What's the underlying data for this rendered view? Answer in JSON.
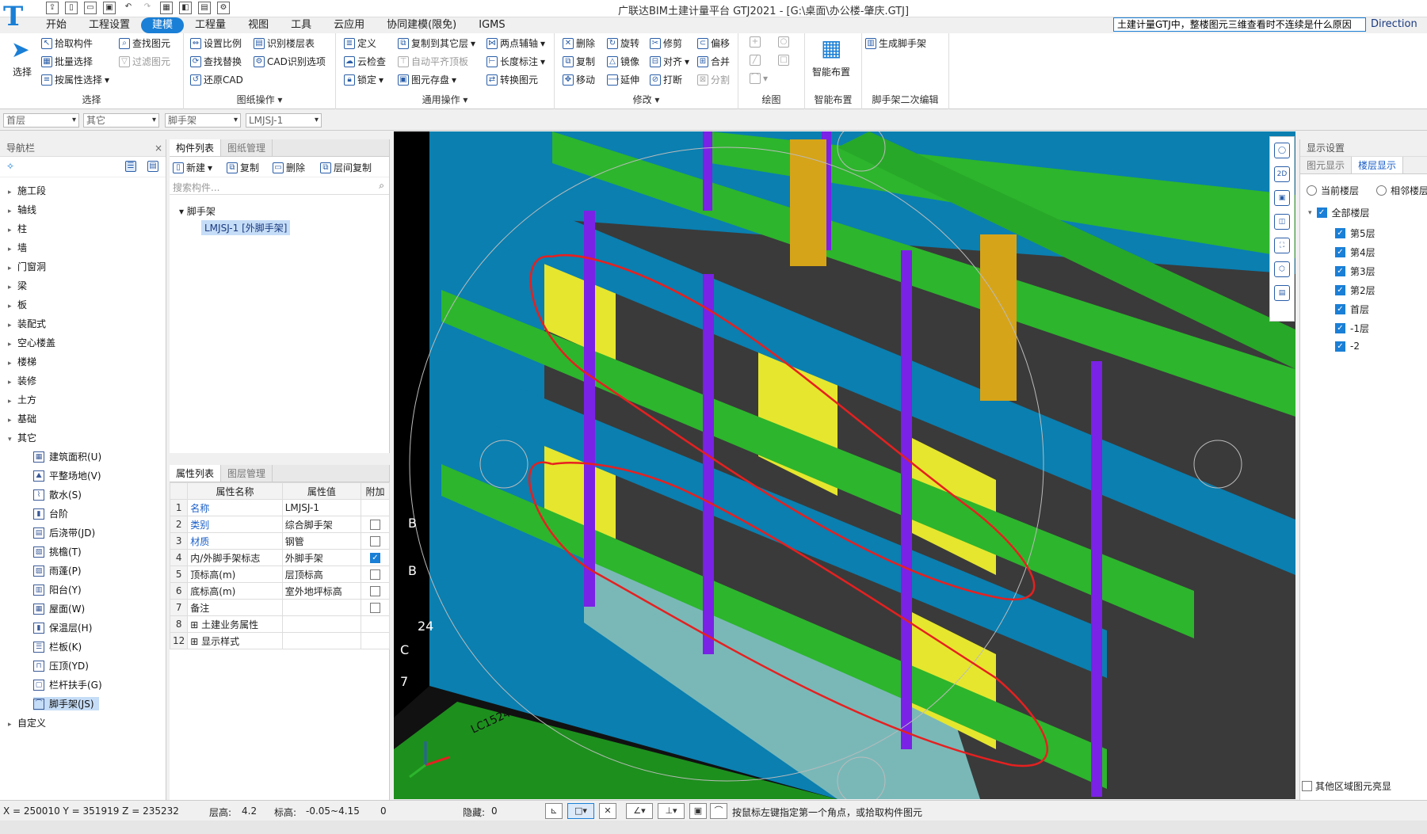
{
  "window": {
    "title": "广联达BIM土建计量平台 GTJ2021 - [G:\\桌面\\办公楼-肇庆.GTJ]",
    "logo": "T"
  },
  "menu": [
    "开始",
    "工程设置",
    "建模",
    "工程量",
    "视图",
    "工具",
    "云应用",
    "协同建模(限免)",
    "IGMS"
  ],
  "help_search": "土建计量GTJ中，整楼图元三维查看时不连续是什么原因",
  "direction_label": "Direction",
  "ribbon": {
    "select": {
      "label": "选择",
      "big": "选择",
      "items": [
        "拾取构件",
        "批量选择",
        "按属性选择",
        "查找图元",
        "过滤图元"
      ]
    },
    "drawing": {
      "label": "图纸操作",
      "items": [
        "设置比例",
        "查找替换",
        "还原CAD",
        "识别楼层表",
        "CAD识别选项"
      ]
    },
    "general": {
      "label": "通用操作",
      "items": [
        "定义",
        "云检查",
        "锁定",
        "复制到其它层",
        "自动平齐顶板",
        "图元存盘",
        "两点辅轴",
        "长度标注",
        "转换图元"
      ]
    },
    "modify": {
      "label": "修改",
      "items": [
        "删除",
        "复制",
        "移动",
        "旋转",
        "镜像",
        "延伸",
        "修剪",
        "对齐",
        "打断",
        "偏移",
        "合并",
        "分割"
      ]
    },
    "draw": {
      "label": "绘图"
    },
    "smart": {
      "label": "智能布置",
      "big": "智能布置"
    },
    "scaffold": {
      "label": "脚手架二次编辑",
      "items": [
        "生成脚手架"
      ]
    }
  },
  "selectors": [
    "首层",
    "其它",
    "脚手架",
    "LMJSJ-1"
  ],
  "nav": {
    "title": "导航栏",
    "items": [
      "施工段",
      "轴线",
      "柱",
      "墙",
      "门窗洞",
      "梁",
      "板",
      "装配式",
      "空心楼盖",
      "楼梯",
      "装修",
      "土方",
      "基础",
      "其它"
    ],
    "sub_items": [
      "建筑面积(U)",
      "平整场地(V)",
      "散水(S)",
      "台阶",
      "后浇带(JD)",
      "挑檐(T)",
      "雨蓬(P)",
      "阳台(Y)",
      "屋面(W)",
      "保温层(H)",
      "栏板(K)",
      "压顶(YD)",
      "栏杆扶手(G)",
      "脚手架(JS)"
    ],
    "last": "自定义"
  },
  "component": {
    "tabs": [
      "构件列表",
      "图纸管理"
    ],
    "tools": [
      "新建",
      "复制",
      "删除",
      "层间复制"
    ],
    "search_placeholder": "搜索构件...",
    "tree_root": "脚手架",
    "tree_item": "LMJSJ-1 [外脚手架]"
  },
  "props": {
    "tabs": [
      "属性列表",
      "图层管理"
    ],
    "headers": [
      "属性名称",
      "属性值",
      "附加"
    ],
    "rows": [
      {
        "n": "1",
        "name": "名称",
        "value": "LMJSJ-1",
        "check": null
      },
      {
        "n": "2",
        "name": "类别",
        "value": "综合脚手架",
        "check": false
      },
      {
        "n": "3",
        "name": "材质",
        "value": "钢管",
        "check": false
      },
      {
        "n": "4",
        "name": "内/外脚手架标志",
        "value": "外脚手架",
        "check": true
      },
      {
        "n": "5",
        "name": "顶标高(m)",
        "value": "层顶标高",
        "check": false
      },
      {
        "n": "6",
        "name": "底标高(m)",
        "value": "室外地坪标高",
        "check": false
      },
      {
        "n": "7",
        "name": "备注",
        "value": "",
        "check": false
      },
      {
        "n": "8",
        "name": "土建业务属性",
        "value": "",
        "check": null
      },
      {
        "n": "12",
        "name": "显示样式",
        "value": "",
        "check": null
      }
    ]
  },
  "display": {
    "title": "显示设置",
    "tabs": [
      "图元显示",
      "楼层显示"
    ],
    "radios": [
      "当前楼层",
      "相邻楼层"
    ],
    "all": "全部楼层",
    "floors": [
      "第5层",
      "第4层",
      "第3层",
      "第2层",
      "首层",
      "-1层",
      "-2"
    ],
    "bottom": "其他区域图元亮显"
  },
  "status": {
    "coords": "X = 250010 Y = 351919 Z = 235232",
    "floor_height_label": "层高:",
    "floor_height": "4.2",
    "elev_label": "标高:",
    "elev": "-0.05~4.15",
    "count": "0",
    "hidden_label": "隐藏:",
    "hidden": "0",
    "hint": "按鼠标左键指定第一个角点，或拾取构件图元"
  },
  "viewport_labels": [
    "B",
    "B",
    "24",
    "C",
    "7",
    "LC1524"
  ],
  "colors": {
    "accent": "#1a7fd6",
    "beam": "#2db52d",
    "wall": "#0a7fb0",
    "column": "#7a22e6",
    "window": "#e6e62e",
    "annot": "#e62020"
  }
}
